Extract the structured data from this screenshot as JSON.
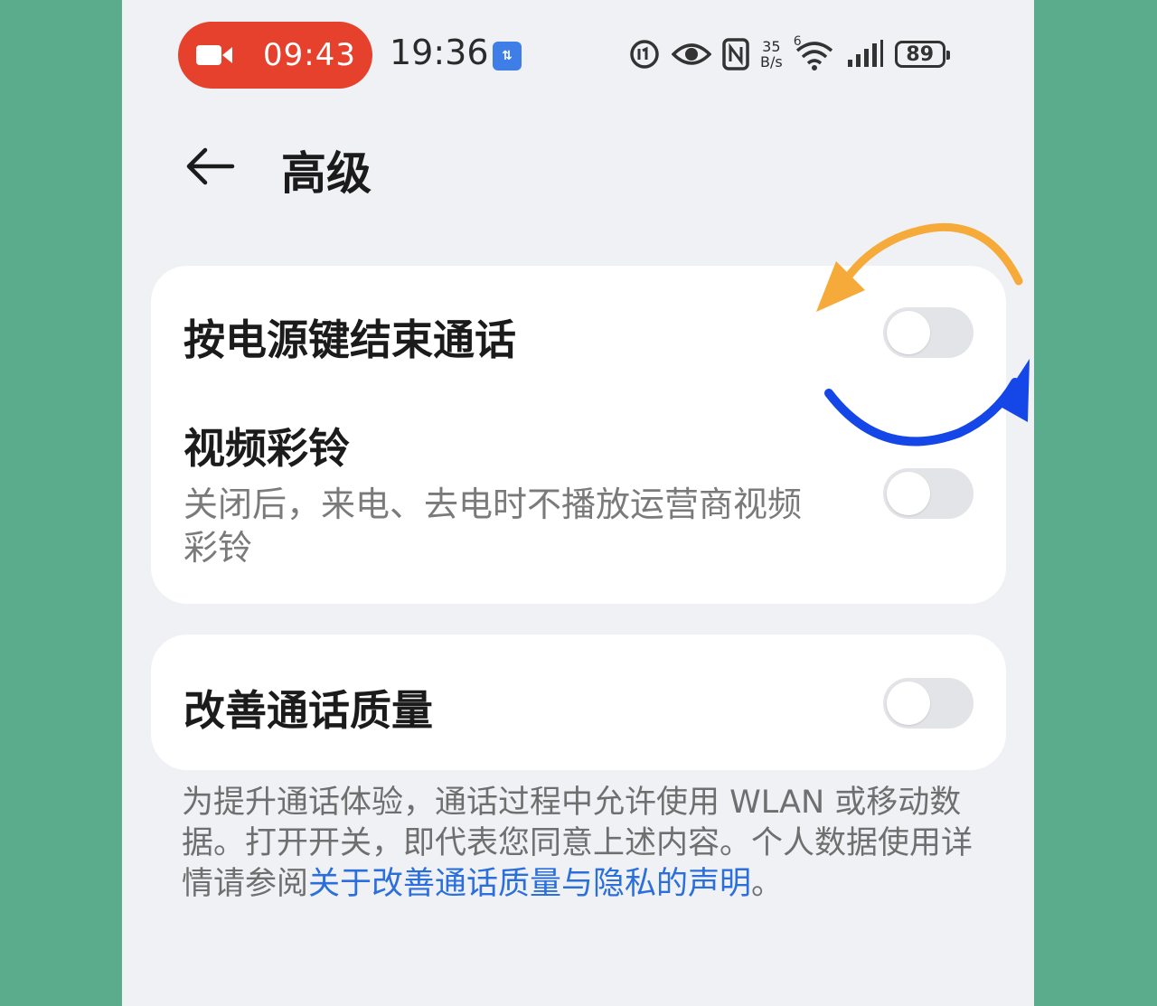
{
  "status_bar": {
    "recording_time": "09:43",
    "clock": "19:36",
    "data_badge": "⇅",
    "net_speed_value": "35",
    "net_speed_unit": "B/s",
    "wifi_label": "6",
    "battery": "89"
  },
  "header": {
    "title": "高级"
  },
  "settings": {
    "power_end_call": {
      "label": "按电源键结束通话",
      "enabled": false
    },
    "video_ringtone": {
      "label": "视频彩铃",
      "description": "关闭后，来电、去电时不播放运营商视频彩铃",
      "enabled": false
    },
    "improve_call_quality": {
      "label": "改善通话质量",
      "enabled": false
    }
  },
  "footnote": {
    "text": "为提升通话体验，通话过程中允许使用 WLAN 或移动数据。打开开关，即代表您同意上述内容。个人数据使用详情请参阅",
    "link": "关于改善通话质量与隐私的声明",
    "end": "。"
  },
  "colors": {
    "recording_pill": "#e5412c",
    "link": "#2a6fdb",
    "overlay_orange": "#f6aa3a",
    "overlay_blue": "#1547e8",
    "background": "#5aac8c"
  }
}
